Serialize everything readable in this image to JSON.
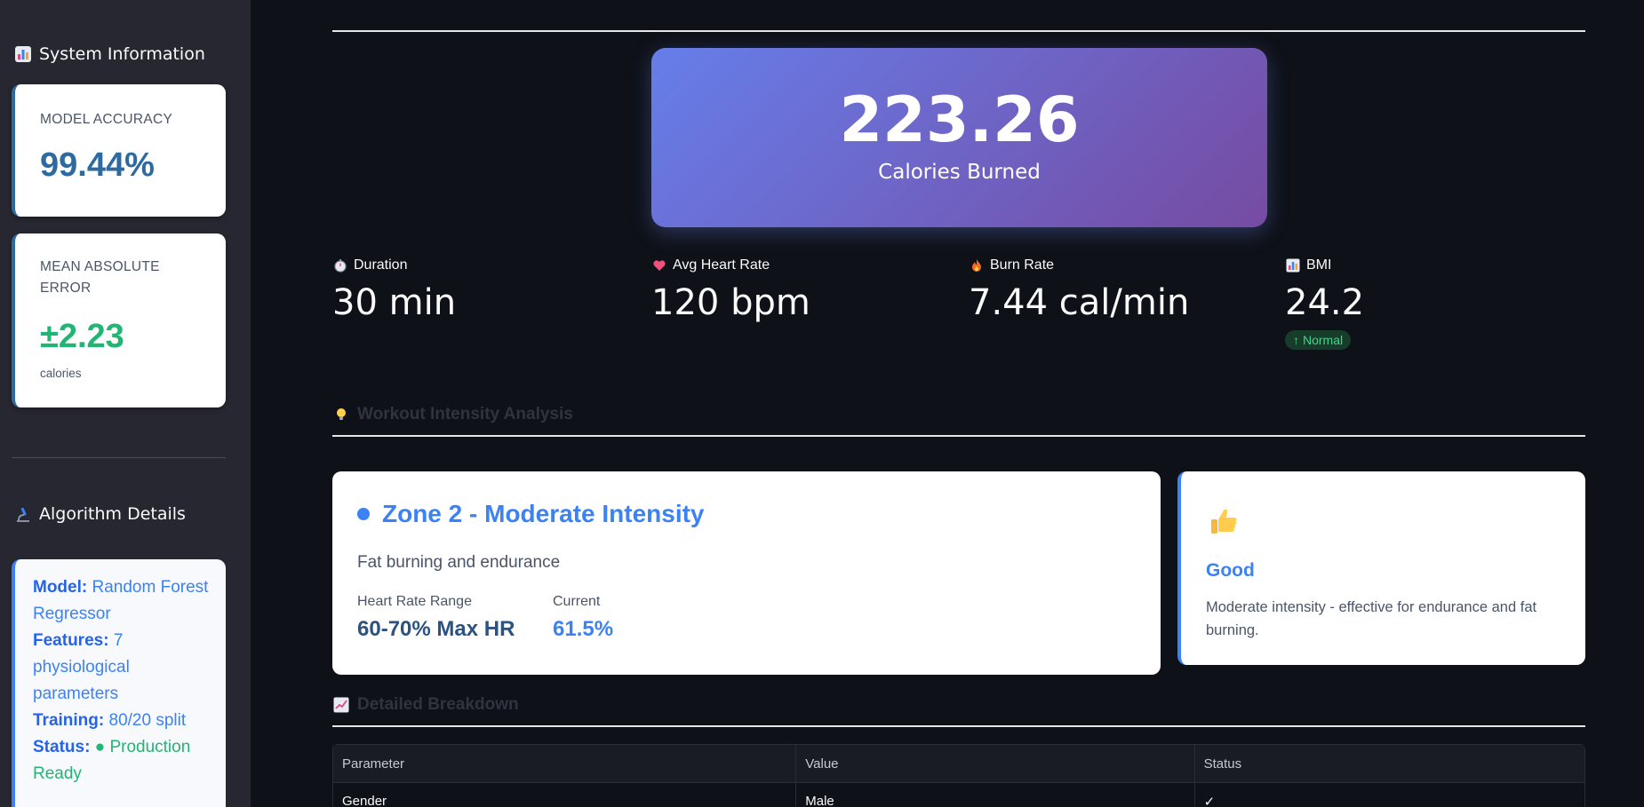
{
  "sidebar": {
    "system_heading": "System Information",
    "accuracy": {
      "label": "MODEL ACCURACY",
      "value": "99.44%",
      "color": "#2d6aa0"
    },
    "mae": {
      "label_line1": "MEAN ABSOLUTE",
      "label_line2": "ERROR",
      "value": "±2.23",
      "unit": "calories",
      "color": "#22b573"
    },
    "algo_heading": "Algorithm Details",
    "algo": {
      "model_key": "Model:",
      "model_val": "Random Forest Regressor",
      "features_key": "Features:",
      "features_val": "7 physiological parameters",
      "training_key": "Training:",
      "training_val": "80/20 split",
      "status_key": "Status:",
      "status_val": "● Production Ready"
    }
  },
  "hero": {
    "value": "223.26",
    "label": "Calories Burned"
  },
  "stats": [
    {
      "icon": "stopwatch-icon",
      "label": "Duration",
      "value": "30 min"
    },
    {
      "icon": "heart-icon",
      "label": "Avg Heart Rate",
      "value": "120 bpm"
    },
    {
      "icon": "fire-icon",
      "label": "Burn Rate",
      "value": "7.44 cal/min"
    },
    {
      "icon": "chart-icon",
      "label": "BMI",
      "value": "24.2",
      "badge": "Normal"
    }
  ],
  "intensity_section": {
    "title": "Workout Intensity Analysis"
  },
  "zone": {
    "title": "Zone 2 - Moderate Intensity",
    "description": "Fat burning and endurance",
    "hr_range_label": "Heart Rate Range",
    "hr_range_value": "60-70% Max HR",
    "current_label": "Current",
    "current_value": "61.5%"
  },
  "rating": {
    "icon": "thumbs-up-icon",
    "title": "Good",
    "description": "Moderate intensity - effective for endurance and fat burning."
  },
  "breakdown_section": {
    "title": "Detailed Breakdown"
  },
  "table": {
    "headers": [
      "Parameter",
      "Value",
      "Status"
    ],
    "rows": [
      [
        "Gender",
        "Male",
        "✓"
      ]
    ]
  }
}
